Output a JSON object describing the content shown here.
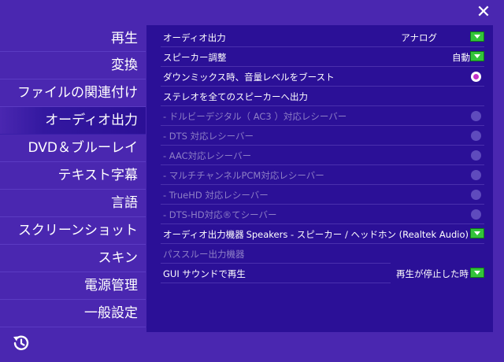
{
  "window": {
    "close_label": "✕"
  },
  "sidebar": {
    "items": [
      {
        "label": "再生"
      },
      {
        "label": "変換"
      },
      {
        "label": "ファイルの関連付け"
      },
      {
        "label": "オーディオ出力",
        "active": true
      },
      {
        "label": "DVD＆ブルーレイ"
      },
      {
        "label": "テキスト字幕"
      },
      {
        "label": "言語"
      },
      {
        "label": "スクリーンショット"
      },
      {
        "label": "スキン"
      },
      {
        "label": "電源管理"
      },
      {
        "label": "一般設定"
      }
    ],
    "restore_icon": "restore-history-icon"
  },
  "settings": {
    "audio_output": {
      "label": "オーディオ出力",
      "value": "アナログ"
    },
    "speaker_adjust": {
      "label": "スピーカー調整",
      "value": "自動"
    },
    "downmix_boost": {
      "label": "ダウンミックス時、音量レベルをブースト",
      "checked": true
    },
    "stereo_all": {
      "label": "ステレオを全てのスピーカーへ出力"
    },
    "dolby": {
      "label": "- ドルビーデジタル（ AC3 ）対応レシーバー"
    },
    "dts": {
      "label": "- DTS 対応レシーバー"
    },
    "aac": {
      "label": "- AAC対応レシーバー"
    },
    "pcm": {
      "label": "- マルチチャンネルPCM対応レシーバー"
    },
    "truehd": {
      "label": "- TrueHD 対応レシーバー"
    },
    "dtshd": {
      "label": "- DTS-HD対応®てシーバー"
    },
    "device": {
      "label": "オーディオ出力機器",
      "value": "Speakers - スピーカー / ヘッドホン (Realtek Audio)"
    },
    "passthrough": {
      "label": "パススルー出力機器"
    },
    "gui_sound": {
      "label": "GUI サウンドで再生",
      "value": "再生が停止した時"
    }
  },
  "colors": {
    "background": "#4a27b0",
    "panel": "#2b1097",
    "accent_green": "#33c43a",
    "radio_selected": "#c430c8"
  }
}
